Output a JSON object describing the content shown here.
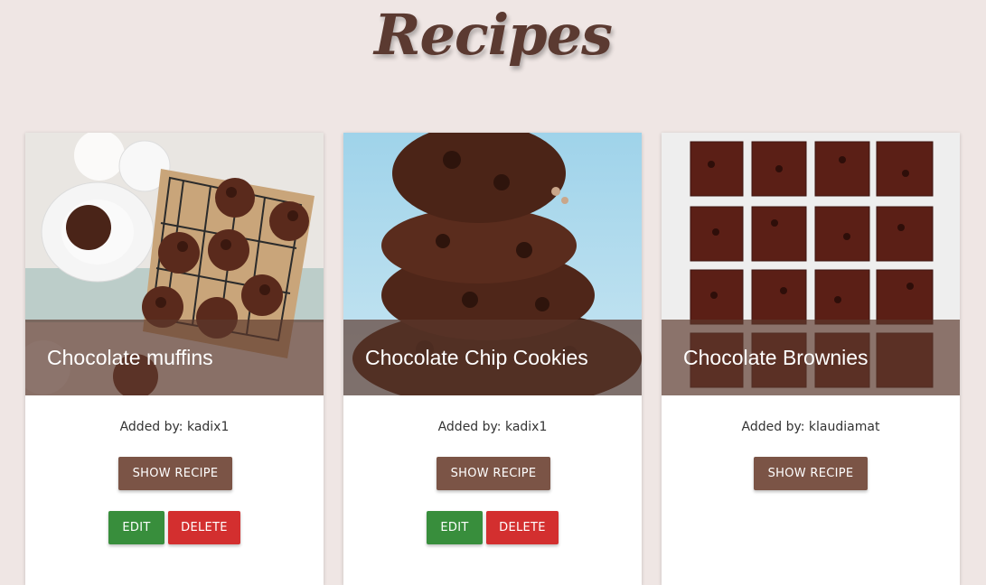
{
  "page": {
    "title": "Recipes"
  },
  "recipes": [
    {
      "title": "Chocolate muffins",
      "added_by": "Added by: kadix1",
      "show_label": "SHOW RECIPE",
      "edit_label": "EDIT",
      "delete_label": "DELETE"
    },
    {
      "title": "Chocolate Chip Cookies",
      "added_by": "Added by: kadix1",
      "show_label": "SHOW RECIPE",
      "edit_label": "EDIT",
      "delete_label": "DELETE"
    },
    {
      "title": "Chocolate Brownies",
      "added_by": "Added by: klaudiamat",
      "show_label": "SHOW RECIPE"
    }
  ],
  "colors": {
    "background": "#efe6e4",
    "title": "#5b3a31",
    "overlay": "#5c382c",
    "show_button": "#7b5446",
    "edit_button": "#388e3c",
    "delete_button": "#d32f2f"
  }
}
